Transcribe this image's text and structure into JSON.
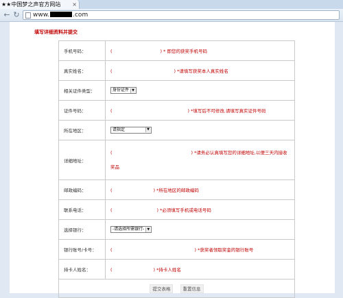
{
  "browser": {
    "tab_title": "★★中国梦之声官方网站",
    "tab_close": "×",
    "url_prefix": "www.",
    "url_suffix": ".com"
  },
  "form": {
    "heading": "填写详细资料并提交",
    "paren_open": "(",
    "paren_close": ")",
    "rows": [
      {
        "label": "手机号码：",
        "hint": "* 即您的获奖手机号码"
      },
      {
        "label": "真实姓名：",
        "hint": "*请填写获奖本人真实姓名"
      },
      {
        "label": "相关证件类型：",
        "select": "身份证件"
      },
      {
        "label": "证件号码：",
        "hint": "*填写后不可修改,请填写真实证件号码"
      },
      {
        "label": "所在地区：",
        "select": "请指定"
      },
      {
        "label": "详细地址：",
        "hint_line1": "*请务必认真填写您的详细地址,以便三天内接收",
        "hint_line2": "奖品"
      },
      {
        "label": "邮政编码：",
        "hint": "*所在地区的邮政编码"
      },
      {
        "label": "联系电话：",
        "hint": "*必须填写手机或电话号码"
      },
      {
        "label": "选择银行：",
        "select": "-请选择所需银行-"
      },
      {
        "label": "银行账号/卡号：",
        "hint": "*获奖者领取奖金的银行账号"
      },
      {
        "label": "持卡人姓名：",
        "hint": "*持卡人姓名"
      }
    ],
    "submit_label": "提交表格",
    "reset_label": "重置信息"
  }
}
